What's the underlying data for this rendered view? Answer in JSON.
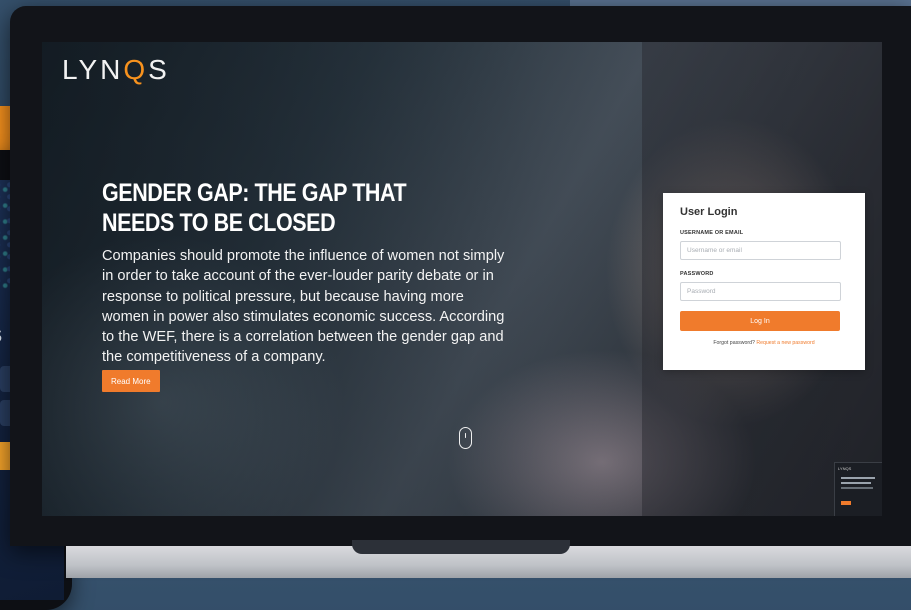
{
  "brand": {
    "logo_left": "LYN",
    "logo_q": "Q",
    "logo_right": "S",
    "accent": "#f07b2c"
  },
  "hero": {
    "title": "GENDER GAP: THE GAP THAT NEEDS TO BE CLOSED",
    "body": "Companies should promote the influence of women not simply in order to take account of the ever-louder parity debate or in response to political pressure, but because having more women in power also stimulates economic success. According to the WEF, there is a correlation between the gender gap and the competitiveness of a company.",
    "read_more": "Read More"
  },
  "login": {
    "title": "User Login",
    "username_label": "USERNAME OR EMAIL",
    "username_placeholder": "Username or email",
    "password_label": "PASSWORD",
    "password_placeholder": "Password",
    "submit": "Log In",
    "forgot_text": "Forgot password?",
    "forgot_link": "Request a new password"
  },
  "phone": {
    "letter": "S"
  },
  "thumbnail": {
    "logo": "LYNQS"
  },
  "icons": [
    "scroll-mouse-icon"
  ]
}
